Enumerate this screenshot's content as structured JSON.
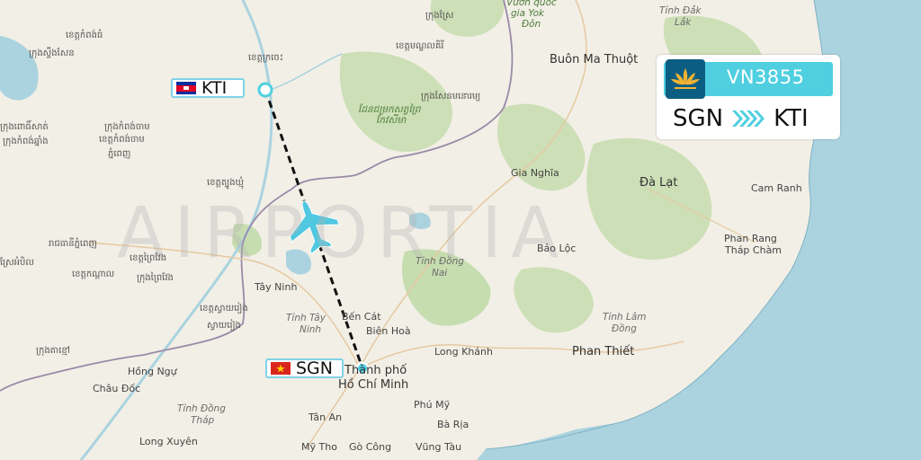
{
  "watermark": "AIRPORTIA",
  "flight": {
    "number": "VN3855",
    "origin": "SGN",
    "destination": "KTI",
    "airline_colors": {
      "band": "#4fcfe0",
      "logo": "#0b5e82",
      "lotus": "#f2b233"
    }
  },
  "airports": {
    "origin": {
      "code": "SGN",
      "flag": "vietnam-flag"
    },
    "destination": {
      "code": "KTI",
      "flag": "cambodia-flag"
    }
  },
  "map_labels": {
    "buon_ma_thuot": "Buôn Ma Thuột",
    "gia_nghia": "Gia Nghĩa",
    "da_lat": "Đà Lạt",
    "cam_ranh": "Cam Ranh",
    "phan_rang": "Phan Rang",
    "thap_cham": "Tháp Chàm",
    "bao_loc": "Bảo Lộc",
    "phan_thiet": "Phan Thiết",
    "tinh_lam_dong_1": "Tỉnh Lâm",
    "tinh_lam_dong_2": "Đồng",
    "tinh_dong_nai_1": "Tỉnh Đồng",
    "tinh_dong_nai_2": "Nai",
    "tinh_dak_lak_1": "Tỉnh Đắk",
    "tinh_dak_lak_2": "Lắk",
    "tay_ninh": "Tây Ninh",
    "tinh_tay_ninh_1": "Tỉnh Tây",
    "tinh_tay_ninh_2": "Ninh",
    "ben_cat": "Bến Cát",
    "tp_1": "Thành phố",
    "tp_2": "Hồ Chí Minh",
    "long_khanh": "Long Khánh",
    "bien_hoa": "Biên Hoà",
    "phu_my": "Phú Mỹ",
    "ba_ria": "Bà Rịa",
    "vung_tau": "Vũng Tàu",
    "go_cong": "Gò Công",
    "my_tho": "Mỹ Tho",
    "tan_an": "Tân An",
    "long_xuyen": "Long Xuyên",
    "chau_doc": "Châu Đốc",
    "hong_ngu": "Hồng Ngự",
    "tinh_dong_thap_1": "Tỉnh Đồng",
    "tinh_dong_thap_2": "Tháp",
    "yok_don_1": "Vườn quốc",
    "yok_don_2": "gia Yok",
    "yok_don_3": "Đôn",
    "kh_1": "ខេត្តកំពង់ធំ",
    "kh_2": "ក្រុងស្ទឹងសែន",
    "kh_3": "ខេត្តក្រចេះ",
    "kh_4": "ខេត្តមណ្ឌលគិរី",
    "kh_5": "ក្រុងសែនមនោរម្យ",
    "kh_6": "ដែនជម្រកសត្វព្រៃ",
    "kh_7": "កែវសីមា",
    "kh_8": "ក្រុងកំពង់ចាម",
    "kh_9": "ខេត្តកំពង់ចាម",
    "kh_10": "ខេត្តត្បូងឃ្មុំ",
    "kh_11": "ភ្នំពេញ",
    "kh_12": "រាជធានីភ្នំពេញ",
    "kh_13": "ខេត្តព្រៃវែង",
    "kh_14": "ក្រុងព្រៃវែង",
    "kh_15": "ខេត្តកណ្ដាល",
    "kh_16": "ខេត្តស្វាយរៀង",
    "kh_17": "ស្វាយរៀង",
    "kh_18": "ក្រុងតាខ្មៅ",
    "kh_19": "ក្រុងកំពង់ឆ្នាំង",
    "kh_20": "ក្រុងពោធិ៍សាត់",
    "kh_21": "ស្រែអំបិល",
    "kh_22": "ក្រុងស្រែ"
  }
}
